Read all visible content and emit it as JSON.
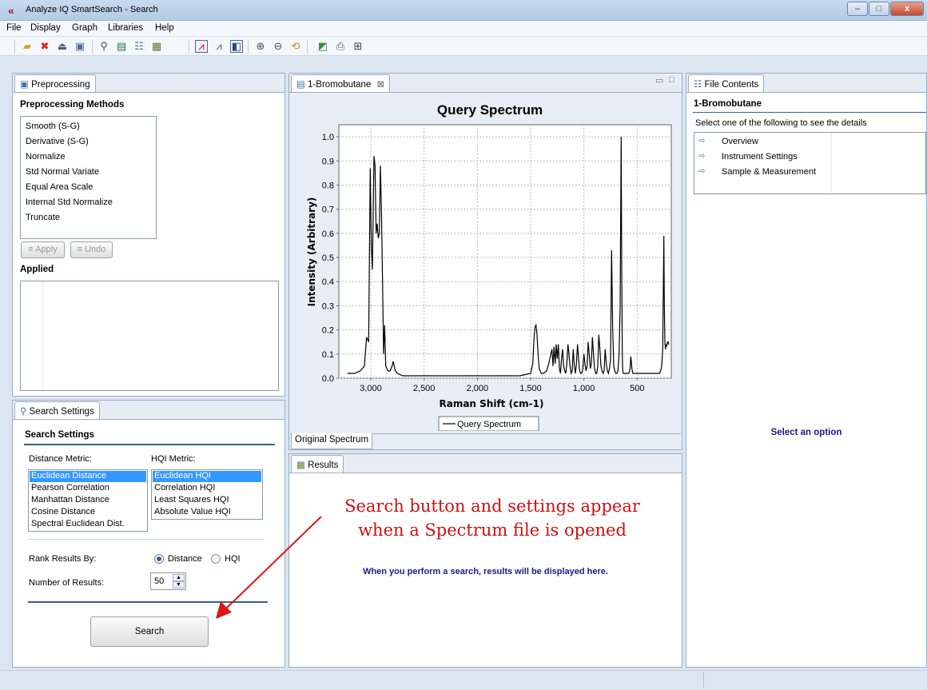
{
  "window": {
    "title": "Analyze IQ SmartSearch - Search",
    "minimize": "–",
    "maximize": "□",
    "close": "x"
  },
  "menu": [
    "File",
    "Display",
    "Graph",
    "Libraries",
    "Help"
  ],
  "toolbar_icons": [
    "open-folder-icon",
    "delete-icon",
    "import-icon",
    "save-icon",
    "zoom-search-icon",
    "preprocess-icon",
    "file-tree-icon",
    "export-icon",
    "chart-line-icon",
    "chart-overlay-icon",
    "back-arrow-icon",
    "zoom-in-icon",
    "zoom-out-icon",
    "reset-zoom-icon",
    "palette-icon",
    "print-icon",
    "layout-icon"
  ],
  "preprocessing": {
    "tab_label": "Preprocessing",
    "section_title": "Preprocessing Methods",
    "methods": [
      "Smooth (S-G)",
      "Derivative (S-G)",
      "Normalize",
      "Std Normal Variate",
      "Equal Area Scale",
      "Internal Std Normalize",
      "Truncate"
    ],
    "apply_label": "Apply",
    "undo_label": "Undo",
    "applied_title": "Applied"
  },
  "search_settings": {
    "tab_label": "Search Settings",
    "section_title": "Search Settings",
    "distance_label": "Distance Metric:",
    "hqi_label": "HQI Metric:",
    "distance_options": [
      "Euclidean Distance",
      "Pearson Correlation",
      "Manhattan Distance",
      "Cosine Distance",
      "Spectral Euclidean Dist."
    ],
    "hqi_options": [
      "Euclidean HQI",
      "Correlation HQI",
      "Least Squares HQI",
      "Absolute Value HQI"
    ],
    "rank_label": "Rank Results By:",
    "rank_option_distance": "Distance",
    "rank_option_hqi": "HQI",
    "num_results_label": "Number of Results:",
    "num_results_value": "50",
    "search_button": "Search"
  },
  "spectrum_tab": {
    "tab_label": "1-Bromobutane",
    "bottom_tab": "Original Spectrum"
  },
  "chart_data": {
    "type": "line",
    "title": "Query Spectrum",
    "xlabel": "Raman Shift (cm-1)",
    "ylabel": "Intensity (Arbitrary)",
    "x_reversed": true,
    "xlim": [
      3300,
      180
    ],
    "ylim": [
      0,
      1.05
    ],
    "xticks": [
      3000,
      2500,
      2000,
      1500,
      1000,
      500
    ],
    "xtick_labels": [
      "3,000",
      "2,500",
      "2,000",
      "1,500",
      "1,000",
      "500"
    ],
    "yticks": [
      0,
      0.1,
      0.2,
      0.3,
      0.4,
      0.5,
      0.6,
      0.7,
      0.8,
      0.9,
      1.0
    ],
    "ytick_labels": [
      "0.0",
      "0.1",
      "0.2",
      "0.3",
      "0.4",
      "0.5",
      "0.6",
      "0.7",
      "0.8",
      "0.9",
      "1.0"
    ],
    "grid": true,
    "legend": "bottom-center",
    "series": [
      {
        "name": "Query Spectrum",
        "color": "#000000",
        "x": [
          3220,
          3150,
          3100,
          3060,
          3040,
          3020,
          3005,
          2995,
          2985,
          2970,
          2960,
          2950,
          2940,
          2930,
          2920,
          2910,
          2900,
          2890,
          2880,
          2870,
          2860,
          2840,
          2820,
          2800,
          2790,
          2780,
          2770,
          2750,
          2700,
          2600,
          2400,
          2200,
          2000,
          1800,
          1600,
          1500,
          1480,
          1470,
          1460,
          1450,
          1440,
          1430,
          1420,
          1400,
          1380,
          1350,
          1330,
          1310,
          1300,
          1290,
          1280,
          1270,
          1260,
          1250,
          1240,
          1230,
          1220,
          1210,
          1200,
          1190,
          1180,
          1170,
          1160,
          1150,
          1140,
          1130,
          1120,
          1110,
          1100,
          1090,
          1080,
          1070,
          1060,
          1050,
          1040,
          1030,
          1020,
          1010,
          1000,
          990,
          980,
          970,
          960,
          950,
          940,
          930,
          920,
          910,
          900,
          890,
          880,
          870,
          860,
          850,
          840,
          830,
          820,
          810,
          800,
          790,
          780,
          770,
          760,
          750,
          740,
          730,
          720,
          710,
          700,
          690,
          680,
          670,
          660,
          650,
          645,
          640,
          635,
          630,
          620,
          610,
          600,
          590,
          580,
          570,
          565,
          560,
          555,
          550,
          545,
          540,
          530,
          520,
          510,
          500,
          490,
          480,
          470,
          460,
          450,
          440,
          430,
          420,
          410,
          400,
          390,
          380,
          370,
          360,
          350,
          340,
          330,
          320,
          310,
          300,
          290,
          280,
          270,
          260,
          250,
          245,
          240,
          235,
          230,
          225,
          220,
          215,
          210,
          205,
          200
        ],
        "y": [
          0.02,
          0.02,
          0.03,
          0.05,
          0.17,
          0.15,
          0.87,
          0.55,
          0.45,
          0.92,
          0.88,
          0.6,
          0.64,
          0.58,
          0.6,
          0.88,
          0.7,
          0.4,
          0.1,
          0.22,
          0.05,
          0.03,
          0.03,
          0.05,
          0.07,
          0.05,
          0.03,
          0.02,
          0.01,
          0.01,
          0.01,
          0.01,
          0.01,
          0.01,
          0.01,
          0.02,
          0.06,
          0.15,
          0.21,
          0.22,
          0.18,
          0.1,
          0.04,
          0.02,
          0.02,
          0.03,
          0.06,
          0.1,
          0.12,
          0.05,
          0.13,
          0.06,
          0.14,
          0.08,
          0.14,
          0.04,
          0.02,
          0.08,
          0.12,
          0.05,
          0.03,
          0.02,
          0.06,
          0.14,
          0.1,
          0.05,
          0.02,
          0.03,
          0.12,
          0.05,
          0.02,
          0.06,
          0.14,
          0.08,
          0.03,
          0.02,
          0.02,
          0.04,
          0.1,
          0.06,
          0.03,
          0.05,
          0.15,
          0.1,
          0.04,
          0.06,
          0.17,
          0.1,
          0.04,
          0.02,
          0.02,
          0.05,
          0.18,
          0.12,
          0.05,
          0.03,
          0.02,
          0.03,
          0.12,
          0.06,
          0.03,
          0.02,
          0.04,
          0.08,
          0.53,
          0.2,
          0.05,
          0.03,
          0.02,
          0.02,
          0.03,
          0.1,
          0.3,
          1.0,
          0.45,
          0.1,
          0.03,
          0.02,
          0.02,
          0.02,
          0.02,
          0.02,
          0.02,
          0.03,
          0.05,
          0.09,
          0.07,
          0.04,
          0.03,
          0.02,
          0.02,
          0.02,
          0.02,
          0.02,
          0.02,
          0.02,
          0.02,
          0.02,
          0.02,
          0.02,
          0.02,
          0.02,
          0.02,
          0.02,
          0.02,
          0.02,
          0.02,
          0.02,
          0.02,
          0.02,
          0.02,
          0.02,
          0.02,
          0.02,
          0.02,
          0.03,
          0.05,
          0.12,
          0.59,
          0.3,
          0.15,
          0.12,
          0.14,
          0.13,
          0.14,
          0.15,
          0.15,
          0.14,
          0.14
        ]
      }
    ]
  },
  "results": {
    "tab_label": "Results",
    "empty_message": "When you perform a search, results will be displayed here."
  },
  "file_contents": {
    "tab_label": "File Contents",
    "file_name": "1-Bromobutane",
    "instruction": "Select one of the following to see the details",
    "options": [
      "Overview",
      "Instrument Settings",
      "Sample & Measurement"
    ],
    "placeholder": "Select an option"
  },
  "annotation": {
    "line1": "Search button and settings appear",
    "line2": "when a Spectrum file is opened",
    "color": "#d01010"
  },
  "colors": {
    "selection": "#3399ff",
    "accent_text": "#1a1a8c",
    "section_divider": "#3a5e8c"
  }
}
